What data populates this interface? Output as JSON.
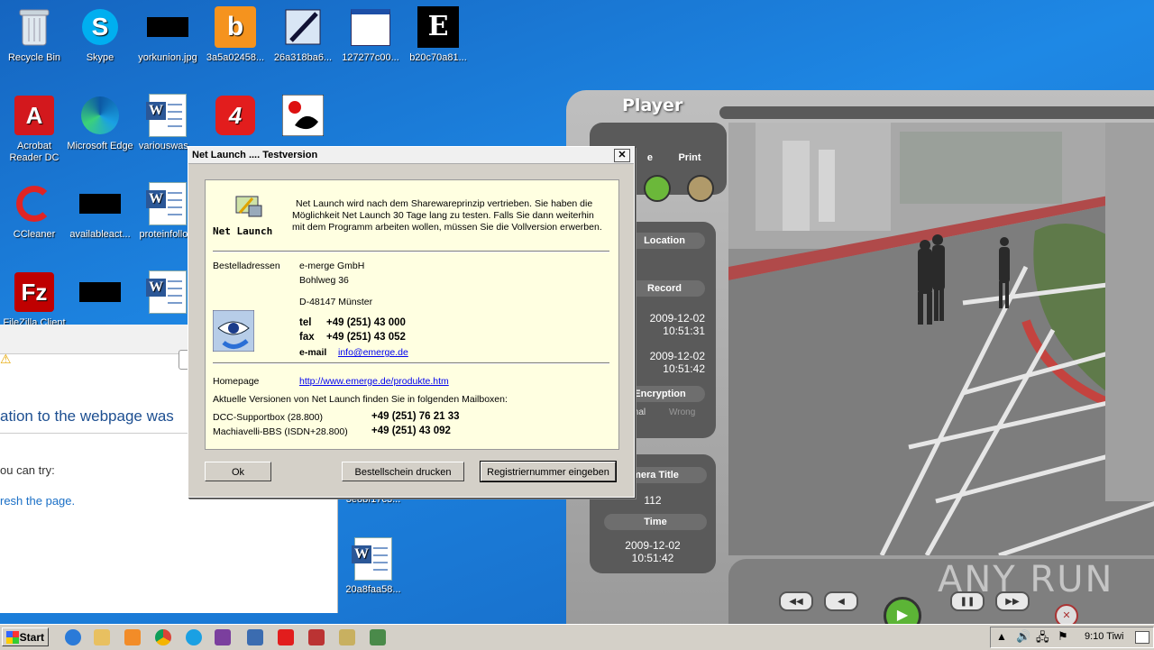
{
  "desktop": {
    "icons": [
      {
        "label": "Recycle Bin"
      },
      {
        "label": "Skype"
      },
      {
        "label": "yorkunion.jpg"
      },
      {
        "label": "3a5a02458..."
      },
      {
        "label": "26a318ba6..."
      },
      {
        "label": "127277c00..."
      },
      {
        "label": "b20c70a81..."
      },
      {
        "label": "Acrobat Reader DC"
      },
      {
        "label": "Microsoft Edge"
      },
      {
        "label": "variouswas..."
      },
      {
        "label": "CCleaner"
      },
      {
        "label": "availableact..."
      },
      {
        "label": "proteinfollo..."
      },
      {
        "label": "FileZilla Client"
      },
      {
        "label": "20a8faa58..."
      },
      {
        "label": "3e8bf17c3..."
      }
    ]
  },
  "browser": {
    "error_heading": "ation to the webpage was",
    "try_text": "ou can try:",
    "refresh_link": "resh the page."
  },
  "player": {
    "title": "Player",
    "labels": {
      "save": "e",
      "print": "Print",
      "location": "Location",
      "record": "Record",
      "encryption": "Encryption",
      "normal": "mal",
      "wrong": "Wrong",
      "camera_title": "mera Title",
      "camera_value": "112",
      "time": "Time"
    },
    "record_start_date": "2009-12-02",
    "record_start_time": "10:51:31",
    "record_end_date": "2009-12-02",
    "record_end_time": "10:51:42",
    "time_date": "2009-12-02",
    "time_time": "10:51:42"
  },
  "dialog": {
    "title": "Net Launch .... Testversion",
    "close": "✕",
    "logo_text": "Net Launch",
    "intro_line1": "Net Launch wird nach dem Sharewareprinzip vertrieben. Sie haben die",
    "intro_line2": "Möglichkeit Net Launch 30 Tage lang zu testen. Falls Sie dann weiterhin",
    "intro_line3": "mit dem Programm arbeiten wollen, müssen Sie die Vollversion erwerben.",
    "order_label": "Bestelladressen",
    "company": "e-merge GmbH",
    "street": "Bohlweg 36",
    "city": "D-48147 Münster",
    "tel_label": "tel",
    "tel": "+49 (251) 43 000",
    "fax_label": "fax",
    "fax": "+49 (251) 43 052",
    "email_label": "e-mail",
    "email": "info@emerge.de",
    "homepage_label": "Homepage",
    "homepage": "http://www.emerge.de/produkte.htm",
    "mailbox_text": "Aktuelle Versionen von Net Launch finden Sie in folgenden Mailboxen:",
    "mailbox1_label": "DCC-Supportbox (28.800)",
    "mailbox1_number": "+49 (251) 76 21 33",
    "mailbox2_label": "Machiavelli-BBS (ISDN+28.800)",
    "mailbox2_number": "+49 (251) 43 092",
    "buttons": {
      "ok": "Ok",
      "print_order": "Bestellschein drucken",
      "register": "Registriernummer eingeben"
    }
  },
  "taskbar": {
    "start": "Start",
    "clock": "9:10 Tiwi"
  },
  "watermark": "ANY RUN"
}
